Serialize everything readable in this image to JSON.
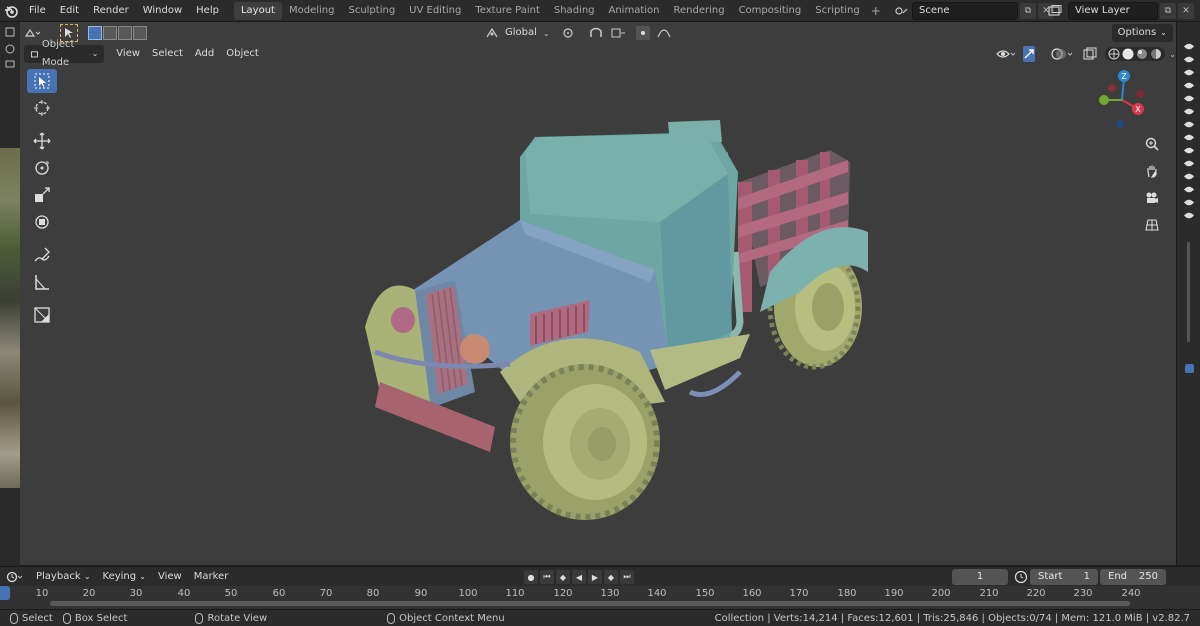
{
  "menu": [
    "File",
    "Edit",
    "Render",
    "Window",
    "Help"
  ],
  "workspaces": [
    "Layout",
    "Modeling",
    "Sculpting",
    "UV Editing",
    "Texture Paint",
    "Shading",
    "Animation",
    "Rendering",
    "Compositing",
    "Scripting"
  ],
  "active_workspace": "Layout",
  "scene": "Scene",
  "view_layer": "View Layer",
  "viewport": {
    "mode": "Object Mode",
    "header_menu": [
      "View",
      "Select",
      "Add",
      "Object"
    ],
    "orientation": "Global",
    "options": "Options"
  },
  "gizmo_labels": {
    "z": "Z",
    "x": "X",
    "y": "Y"
  },
  "timeline": {
    "menu": [
      "Playback",
      "Keying",
      "View",
      "Marker"
    ],
    "current_frame": "1",
    "start_label": "Start",
    "start": "1",
    "end_label": "End",
    "end": "250",
    "ruler": [
      "10",
      "20",
      "30",
      "40",
      "50",
      "60",
      "70",
      "80",
      "90",
      "100",
      "110",
      "120",
      "130",
      "140",
      "150",
      "160",
      "170",
      "180",
      "190",
      "200",
      "210",
      "220",
      "230",
      "240"
    ]
  },
  "status": {
    "select": "Select",
    "box_select": "Box Select",
    "rotate_view": "Rotate View",
    "context_menu": "Object Context Menu",
    "stats": "Collection | Verts:14,214 | Faces:12,601 | Tris:25,846 | Objects:0/74 | Mem: 121.0 MiB | v2.82.7"
  },
  "colors": {
    "accent": "#4772b3",
    "viewport_bg": "#3d3d3d",
    "cab_blue": "#7593b3",
    "teal": "#6ea6a3",
    "olive": "#a9b277",
    "pink": "#b0667e"
  }
}
